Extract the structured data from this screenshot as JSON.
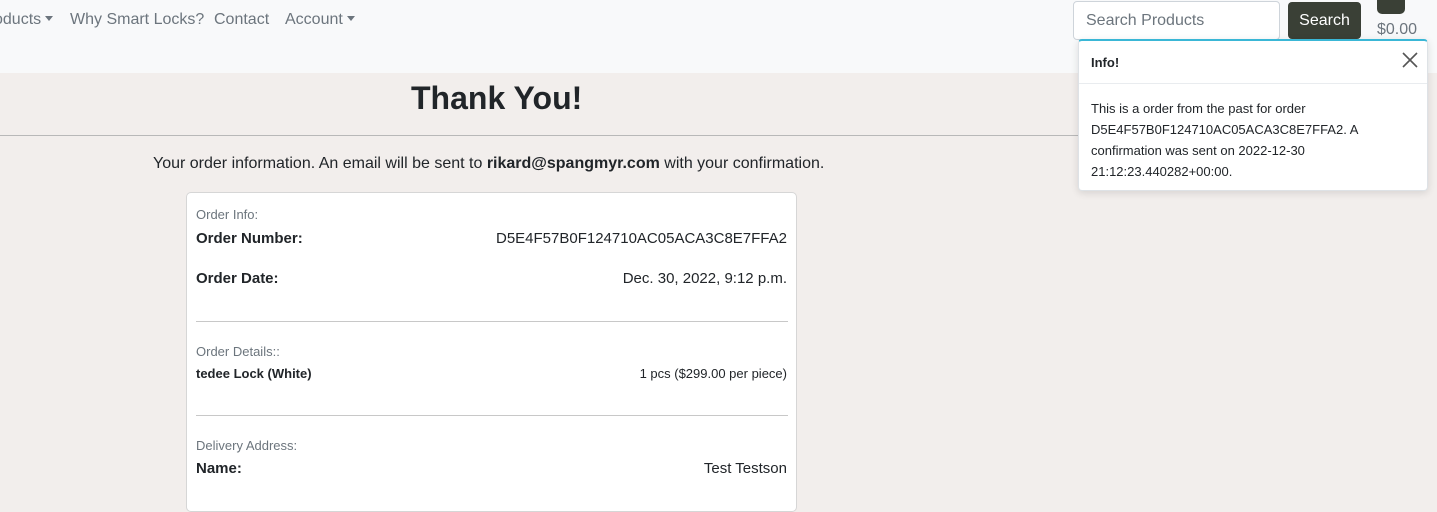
{
  "navbar": {
    "items": [
      {
        "label": "oducts",
        "has_dropdown": true
      },
      {
        "label": "Why Smart Locks?",
        "has_dropdown": false
      },
      {
        "label": "Contact",
        "has_dropdown": false
      },
      {
        "label": "Account",
        "has_dropdown": true
      }
    ],
    "search": {
      "placeholder": "Search Products",
      "value": "",
      "button_label": "Search"
    },
    "cart": {
      "total": "$0.00",
      "icon": "cart-icon"
    }
  },
  "toast": {
    "title": "Info!",
    "body": "This is a order from the past for order D5E4F57B0F124710AC05ACA3C8E7FFA2. A confirmation was sent on 2022-12-30 21:12:23.440282+00:00.",
    "close_icon": "close-icon",
    "accent_color": "#3ab7d6"
  },
  "page": {
    "title": "Thank You!",
    "intro_prefix": "Your order information. An email will be sent to ",
    "intro_email": "rikard@spangmyr.com",
    "intro_suffix": " with your confirmation."
  },
  "order": {
    "info_label": "Order Info:",
    "number_label": "Order Number:",
    "number_value": "D5E4F57B0F124710AC05ACA3C8E7FFA2",
    "date_label": "Order Date:",
    "date_value": "Dec. 30, 2022, 9:12 p.m.",
    "details_label": "Order Details::",
    "items": [
      {
        "name": "tedee Lock (White)",
        "qty": "1 pcs ($299.00 per piece)"
      }
    ],
    "delivery_label": "Delivery Address:",
    "name_label": "Name:",
    "name_value": "Test Testson"
  },
  "colors": {
    "background": "#f2eeec",
    "navbar": "#f8f9fa",
    "button": "#3a4036"
  }
}
